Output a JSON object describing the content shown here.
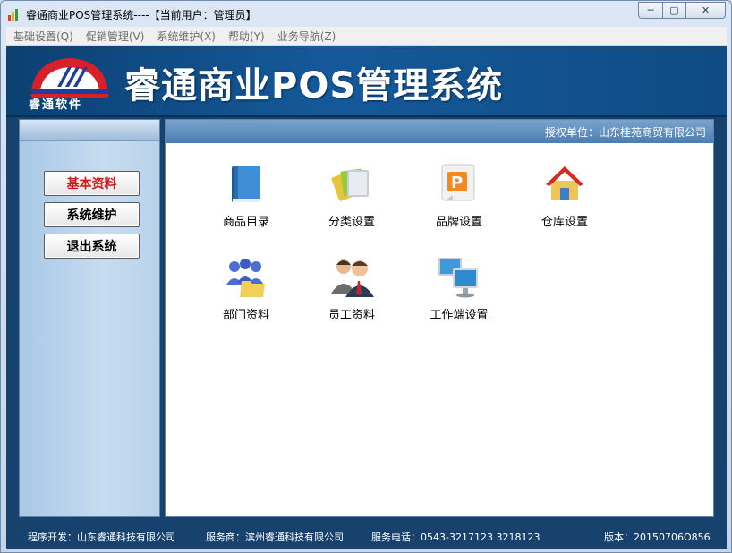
{
  "window": {
    "title": "睿通商业POS管理系统----【当前用户：管理员】",
    "controls": {
      "minimize": "─",
      "maximize": "▢",
      "close": "✕"
    }
  },
  "menu": [
    {
      "label": "基础设置(Q)"
    },
    {
      "label": "促销管理(V)"
    },
    {
      "label": "系统维护(X)"
    },
    {
      "label": "帮助(Y)"
    },
    {
      "label": "业务导航(Z)"
    }
  ],
  "header": {
    "logo_text": "睿通软件",
    "title": "睿通商业POS管理系统"
  },
  "sidebar": {
    "buttons": [
      {
        "label": "基本资料",
        "active": true
      },
      {
        "label": "系统维护",
        "active": false
      },
      {
        "label": "退出系统",
        "active": false
      }
    ]
  },
  "main": {
    "auth_unit": "授权单位：山东桂苑商贸有限公司",
    "tiles": [
      {
        "label": "商品目录",
        "icon": "book-icon"
      },
      {
        "label": "分类设置",
        "icon": "folders-icon"
      },
      {
        "label": "品牌设置",
        "icon": "brand-icon"
      },
      {
        "label": "仓库设置",
        "icon": "warehouse-icon"
      },
      {
        "label": "部门资料",
        "icon": "department-icon"
      },
      {
        "label": "员工资料",
        "icon": "employees-icon"
      },
      {
        "label": "工作端设置",
        "icon": "workstation-icon"
      }
    ]
  },
  "status": {
    "developer": "程序开发：山东睿通科技有限公司",
    "service_provider": "服务商：滨州睿通科技有限公司",
    "phone": "服务电话：0543-3217123  3218123",
    "version": "版本：20150706O856"
  },
  "colors": {
    "header_blue": "#15599a",
    "active_button_text": "#d01a1a",
    "status_bar": "#17426d"
  }
}
